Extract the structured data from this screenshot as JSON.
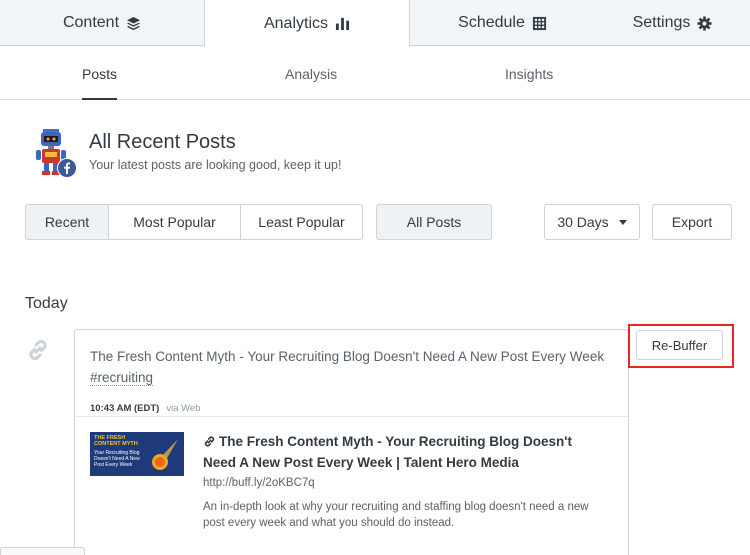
{
  "top_tabs": [
    {
      "label": "Content",
      "icon": "layers-icon"
    },
    {
      "label": "Analytics",
      "icon": "bar-chart-icon",
      "active": true
    },
    {
      "label": "Schedule",
      "icon": "calendar-grid-icon"
    },
    {
      "label": "Settings",
      "icon": "gear-icon"
    }
  ],
  "sub_tabs": [
    {
      "label": "Posts",
      "active": true
    },
    {
      "label": "Analysis"
    },
    {
      "label": "Insights"
    }
  ],
  "header": {
    "title": "All Recent Posts",
    "subtitle": "Your latest posts are looking good, keep it up!",
    "profile_network": "facebook"
  },
  "filters": {
    "sort": [
      "Recent",
      "Most Popular",
      "Least Popular"
    ],
    "sort_selected": "Recent",
    "post_type": "All Posts",
    "range": "30 Days",
    "export": "Export"
  },
  "day_label": "Today",
  "post": {
    "text": "The Fresh Content Myth - Your Recruiting Blog Doesn't Need A New Post Every Week",
    "hashtag": "#recruiting",
    "time": "10:43 AM (EDT)",
    "via": "via Web",
    "rebuffer_label": "Re-Buffer",
    "link": {
      "title": "The Fresh Content Myth - Your Recruiting Blog Doesn't Need A New Post Every Week | Talent Hero Media",
      "url": "http://buff.ly/2oKBC7q",
      "description": "An in-depth look at why your recruiting and staffing blog doesn't need a new post every week and what you should do instead.",
      "thumb_title": "THE FRESH CONTENT MYTH",
      "thumb_sub": "Your Recruiting Blog Doesn't Need A New Post Every Week"
    }
  },
  "colors": {
    "highlight": "#e02b20",
    "facebook": "#3b5998",
    "text_dark": "#323b43",
    "border": "#ccd3d9"
  }
}
